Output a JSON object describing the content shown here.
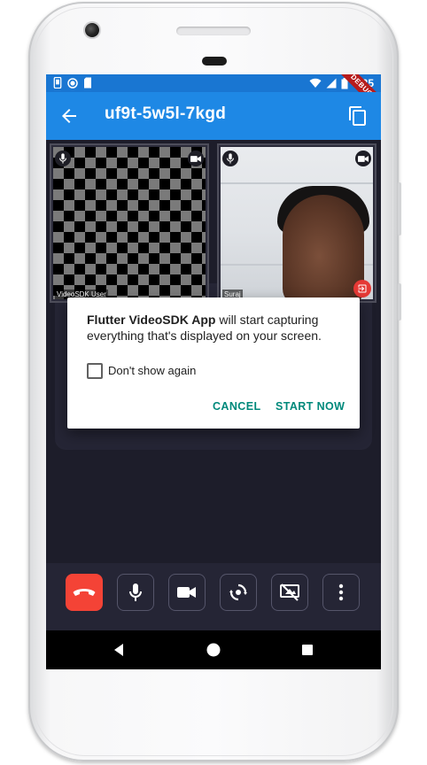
{
  "status_bar": {
    "time": "5:35",
    "debug_label": "DEBUG"
  },
  "app_bar": {
    "title": "uf9t-5w5l-7kgd"
  },
  "participants": [
    {
      "name": "VideoSDK User"
    },
    {
      "name": "Suraj"
    }
  ],
  "dialog": {
    "app_name": "Flutter VideoSDK App",
    "message": " will start capturing everything that's displayed on your screen.",
    "checkbox_label": "Don't show again",
    "checkbox_checked": false,
    "cancel_label": "CANCEL",
    "start_label": "START NOW"
  },
  "colors": {
    "app_bar": "#1e88e5",
    "status_bar": "#1976d2",
    "end_call": "#f44336",
    "dialog_button": "#00897b"
  },
  "controls": [
    {
      "icon": "end-call-icon"
    },
    {
      "icon": "microphone-icon"
    },
    {
      "icon": "video-camera-icon"
    },
    {
      "icon": "switch-camera-icon"
    },
    {
      "icon": "screen-share-off-icon"
    },
    {
      "icon": "more-vertical-icon"
    }
  ]
}
